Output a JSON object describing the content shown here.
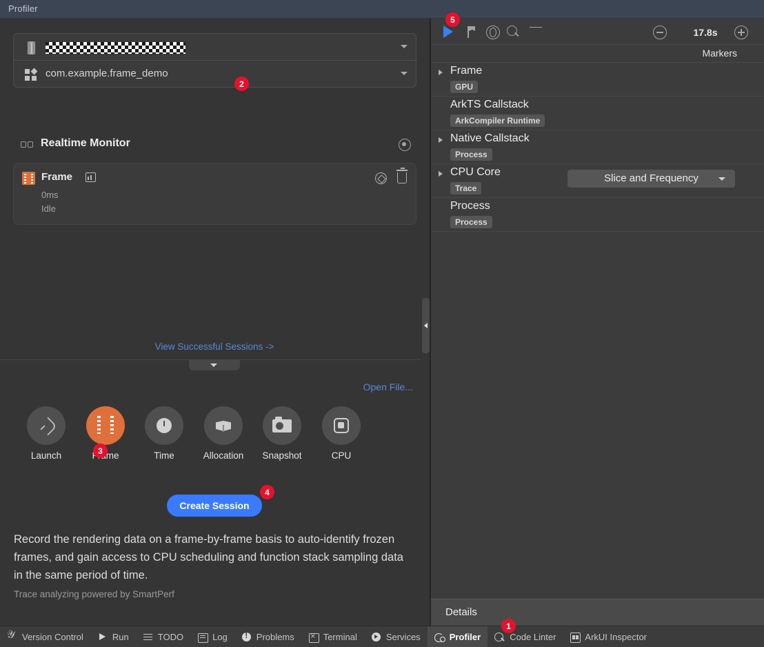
{
  "titlebar": {
    "title": "Profiler"
  },
  "left": {
    "device_selector": {
      "icon": "device-icon",
      "value_masked": true,
      "caret": "chevron-down-icon"
    },
    "app_selector": {
      "icon": "apps-grid-icon",
      "value": "com.example.frame_demo",
      "caret": "chevron-down-icon"
    },
    "realtime_monitor": {
      "title": "Realtime Monitor",
      "icon": "monitor-icon",
      "settings_icon": "target-gear-icon"
    },
    "session_card": {
      "icon": "frame-film-icon",
      "name": "Frame",
      "chart_icon": "chart-icon",
      "time": "0ms",
      "state": "Idle",
      "action_locate_icon": "locate-icon",
      "action_delete_icon": "trash-icon"
    },
    "view_sessions_link": "View Successful Sessions ->",
    "collapse_tab_icon": "chevron-down-icon",
    "open_file_link": "Open File...",
    "modes": [
      {
        "label": "Launch",
        "icon": "rocket-icon",
        "active": false
      },
      {
        "label": "Frame",
        "icon": "film-strip-icon",
        "active": true
      },
      {
        "label": "Time",
        "icon": "clock-icon",
        "active": false
      },
      {
        "label": "Allocation",
        "icon": "cube-icon",
        "active": false
      },
      {
        "label": "Snapshot",
        "icon": "camera-icon",
        "active": false
      },
      {
        "label": "CPU",
        "icon": "cpu-chip-icon",
        "active": false
      }
    ],
    "create_button": "Create Session",
    "description": "Record the rendering data on a frame-by-frame basis to auto-identify frozen frames, and gain access to CPU scheduling and function stack sampling data in the same period of time.",
    "powered_by": "Trace analyzing powered by SmartPerf",
    "splitter_icon": "collapse-left-icon"
  },
  "right": {
    "toolbar": {
      "play_icon": "play-icon",
      "flag_icon": "flag-icon",
      "globe_icon": "globe-icon",
      "search_icon": "search-icon",
      "filter_icon": "filter-icon",
      "zoom_out_icon": "zoom-out-icon",
      "duration": "17.8s",
      "zoom_in_icon": "zoom-in-icon"
    },
    "markers_label": "Markers",
    "tree": [
      {
        "name": "Frame",
        "tag": "GPU",
        "expandable": true,
        "select": null
      },
      {
        "name": "ArkTS Callstack",
        "tag": "ArkCompiler Runtime",
        "expandable": false,
        "select": null
      },
      {
        "name": "Native Callstack",
        "tag": "Process",
        "expandable": true,
        "select": null
      },
      {
        "name": "CPU Core",
        "tag": "Trace",
        "expandable": true,
        "select": "Slice and Frequency"
      },
      {
        "name": "Process",
        "tag": "Process",
        "expandable": false,
        "select": null
      }
    ],
    "details_label": "Details"
  },
  "statusbar": [
    {
      "label": "Version Control",
      "icon": "vcs-icon",
      "active": false
    },
    {
      "label": "Run",
      "icon": "run-icon",
      "active": false
    },
    {
      "label": "TODO",
      "icon": "todo-icon",
      "active": false
    },
    {
      "label": "Log",
      "icon": "log-icon",
      "active": false
    },
    {
      "label": "Problems",
      "icon": "problems-icon",
      "active": false
    },
    {
      "label": "Terminal",
      "icon": "terminal-icon",
      "active": false
    },
    {
      "label": "Services",
      "icon": "services-icon",
      "active": false
    },
    {
      "label": "Profiler",
      "icon": "profiler-icon",
      "active": true
    },
    {
      "label": "Code Linter",
      "icon": "code-linter-icon",
      "active": false
    },
    {
      "label": "ArkUI Inspector",
      "icon": "arkui-inspector-icon",
      "active": false
    }
  ],
  "annotations": [
    {
      "id": "1",
      "label": "1"
    },
    {
      "id": "2",
      "label": "2"
    },
    {
      "id": "3",
      "label": "3"
    },
    {
      "id": "4",
      "label": "4"
    },
    {
      "id": "5",
      "label": "5"
    }
  ],
  "colors": {
    "accent_orange": "#e0703b",
    "accent_blue": "#3a7afe",
    "link_blue": "#5c87d6",
    "badge_red": "#e8112d",
    "panel_bg": "#353535",
    "right_panel_bg": "#3c3c3c",
    "titlebar_bg": "#3c4553"
  }
}
